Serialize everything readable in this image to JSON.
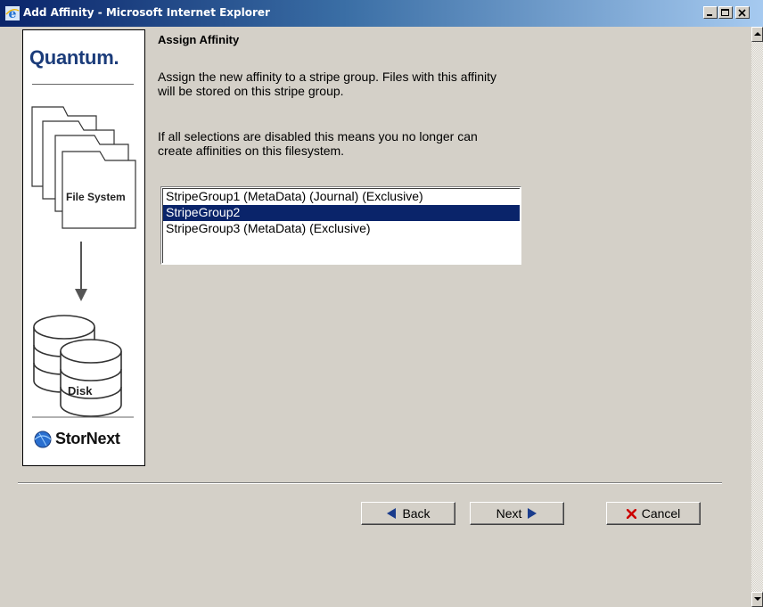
{
  "window": {
    "title": "Add Affinity - Microsoft Internet Explorer",
    "icon": "ie-icon",
    "controls": [
      "minimize-icon",
      "maximize-icon",
      "close-icon"
    ]
  },
  "sidebar": {
    "brand": "Quantum.",
    "graphic_label": "File System",
    "disk_label": "Disk",
    "product": "StorNext"
  },
  "main": {
    "heading": "Assign Affinity",
    "paragraph1_line1": "Assign the new affinity to a stripe group. Files with this affinity",
    "paragraph1_line2": "will be stored on this stripe group.",
    "paragraph2_line1": "If all selections are disabled this means you no longer can",
    "paragraph2_line2": "create affinities on this filesystem.",
    "stripe_groups": [
      "StripeGroup1 (MetaData)  (Journal)  (Exclusive)",
      "StripeGroup2",
      "StripeGroup3 (MetaData)  (Exclusive)"
    ],
    "selected": "StripeGroup2"
  },
  "buttons": {
    "back": "Back",
    "next": "Next",
    "cancel": "Cancel"
  },
  "colors": {
    "titlebar_start": "#0a246a",
    "selection": "#0a246a",
    "brand_blue": "#1b3c7a",
    "cancel_x": "#cc0000",
    "arrow_blue": "#1a3c8c"
  }
}
